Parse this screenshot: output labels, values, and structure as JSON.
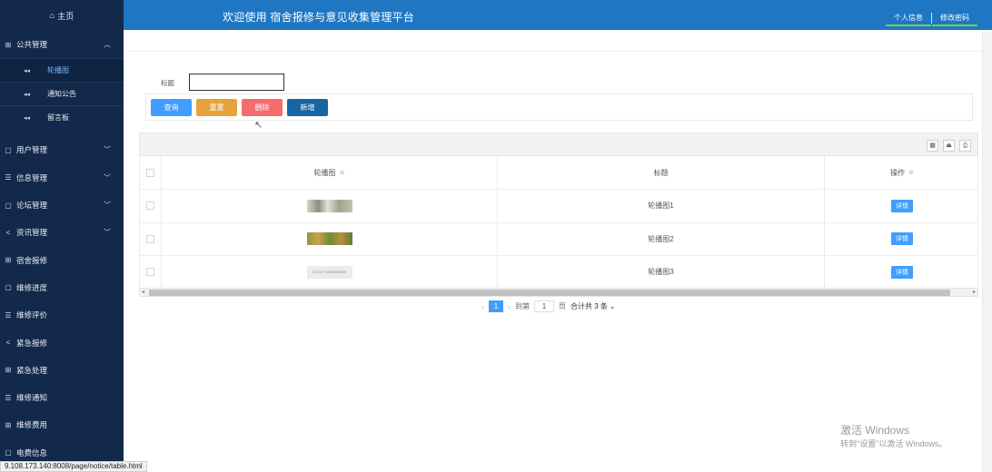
{
  "sidebar": {
    "home": "主页",
    "groups": [
      {
        "label": "公共管理",
        "icon": "grid-icon",
        "expanded": true,
        "subitems": [
          {
            "label": "轮播图",
            "active": true
          },
          {
            "label": "通知公告",
            "active": false
          },
          {
            "label": "留言板",
            "active": false
          }
        ]
      },
      {
        "label": "用户管理",
        "icon": "book-icon"
      },
      {
        "label": "信息管理",
        "icon": "list-icon"
      },
      {
        "label": "论坛管理",
        "icon": "book-icon"
      },
      {
        "label": "资讯管理",
        "icon": "share-icon"
      }
    ],
    "items": [
      {
        "label": "宿舍报修",
        "icon": "grid-icon"
      },
      {
        "label": "维修进度",
        "icon": "book-icon"
      },
      {
        "label": "维修评价",
        "icon": "list-icon"
      },
      {
        "label": "紧急报修",
        "icon": "share-icon"
      },
      {
        "label": "紧急处理",
        "icon": "grid-icon"
      },
      {
        "label": "维修通知",
        "icon": "list-icon"
      },
      {
        "label": "维修费用",
        "icon": "grid-icon"
      },
      {
        "label": "电费信息",
        "icon": "book-icon"
      }
    ]
  },
  "header": {
    "title": "欢迎使用 宿舍报修与意见收集管理平台",
    "links": [
      "个人信息",
      "修改密码"
    ]
  },
  "search": {
    "label": "标题",
    "value": "",
    "buttons": {
      "query": "查询",
      "reset": "重置",
      "delete": "删除",
      "add": "新增"
    }
  },
  "table": {
    "columns": [
      "轮播图",
      "标题",
      "操作"
    ],
    "rows": [
      {
        "title": "轮播图1",
        "action": "详情",
        "thumb_text": ""
      },
      {
        "title": "轮播图2",
        "action": "详情",
        "thumb_text": ""
      },
      {
        "title": "轮播图3",
        "action": "详情",
        "thumb_text": "CLICK TO BROWSE"
      }
    ]
  },
  "pagination": {
    "current": "1",
    "goto_label": "到第",
    "goto_value": "1",
    "page_unit": "页",
    "total": "合计共 3 条"
  },
  "watermark": {
    "line1": "激活 Windows",
    "line2": "转到\"设置\"以激活 Windows。"
  },
  "statusbar": {
    "url": "9.108.173.140:8008/page/notice/table.html"
  },
  "icons": {
    "grid-icon": "⊞",
    "book-icon": "▢",
    "list-icon": "☰",
    "share-icon": "<",
    "home-icon": "⌂"
  }
}
